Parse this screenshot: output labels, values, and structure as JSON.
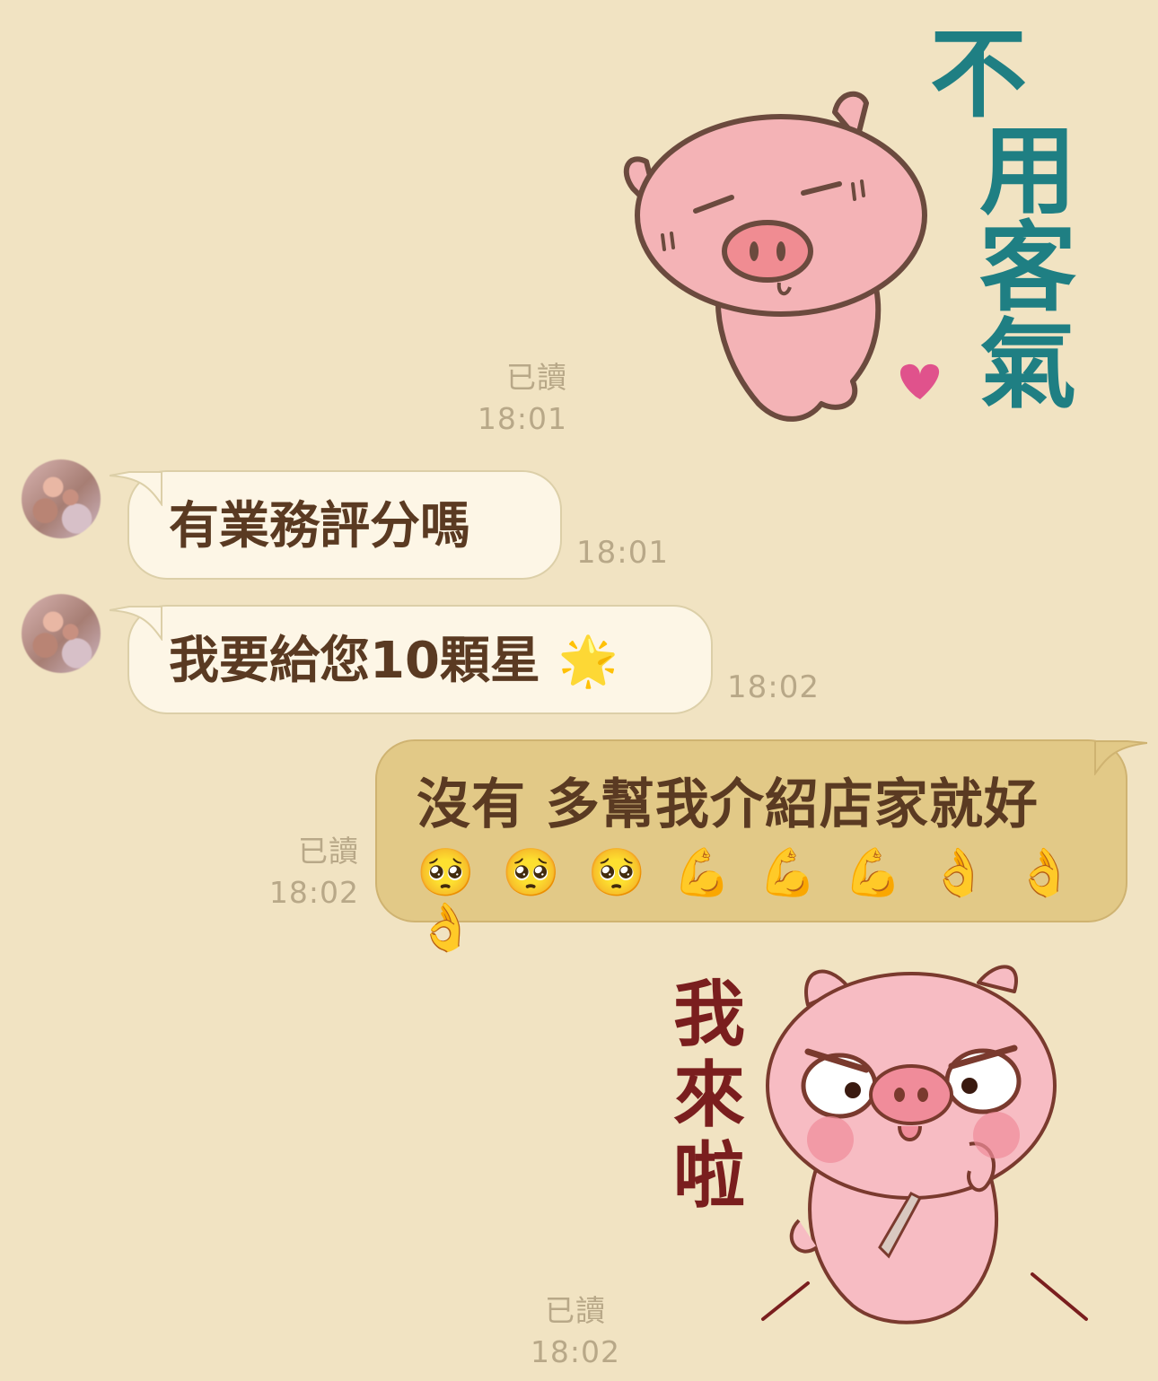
{
  "messages": [
    {
      "id": "m1",
      "type": "sticker",
      "direction": "out",
      "read_label": "已讀",
      "time": "18:01",
      "sticker_text": "不用客氣"
    },
    {
      "id": "m2",
      "type": "text",
      "direction": "in",
      "text": "有業務評分嗎",
      "time": "18:01"
    },
    {
      "id": "m3",
      "type": "text",
      "direction": "in",
      "text": "我要給您10顆星",
      "emoji": "🌟",
      "time": "18:02"
    },
    {
      "id": "m4",
      "type": "text",
      "direction": "out",
      "text": "沒有 多幫我介紹店家就好",
      "emojis": [
        "🥺",
        "🥺",
        "🥺",
        "💪",
        "💪",
        "💪",
        "👌",
        "👌",
        "👌"
      ],
      "read_label": "已讀",
      "time": "18:02"
    },
    {
      "id": "m5",
      "type": "sticker",
      "direction": "out",
      "read_label": "已讀",
      "time": "18:02",
      "sticker_text": [
        "我",
        "來",
        "啦"
      ]
    }
  ],
  "colors": {
    "background": "#f1e3c2",
    "incoming_bubble": "#fdf6e6",
    "outgoing_bubble": "#e2c987",
    "text": "#5a3a22",
    "meta_text": "#b8a888"
  }
}
